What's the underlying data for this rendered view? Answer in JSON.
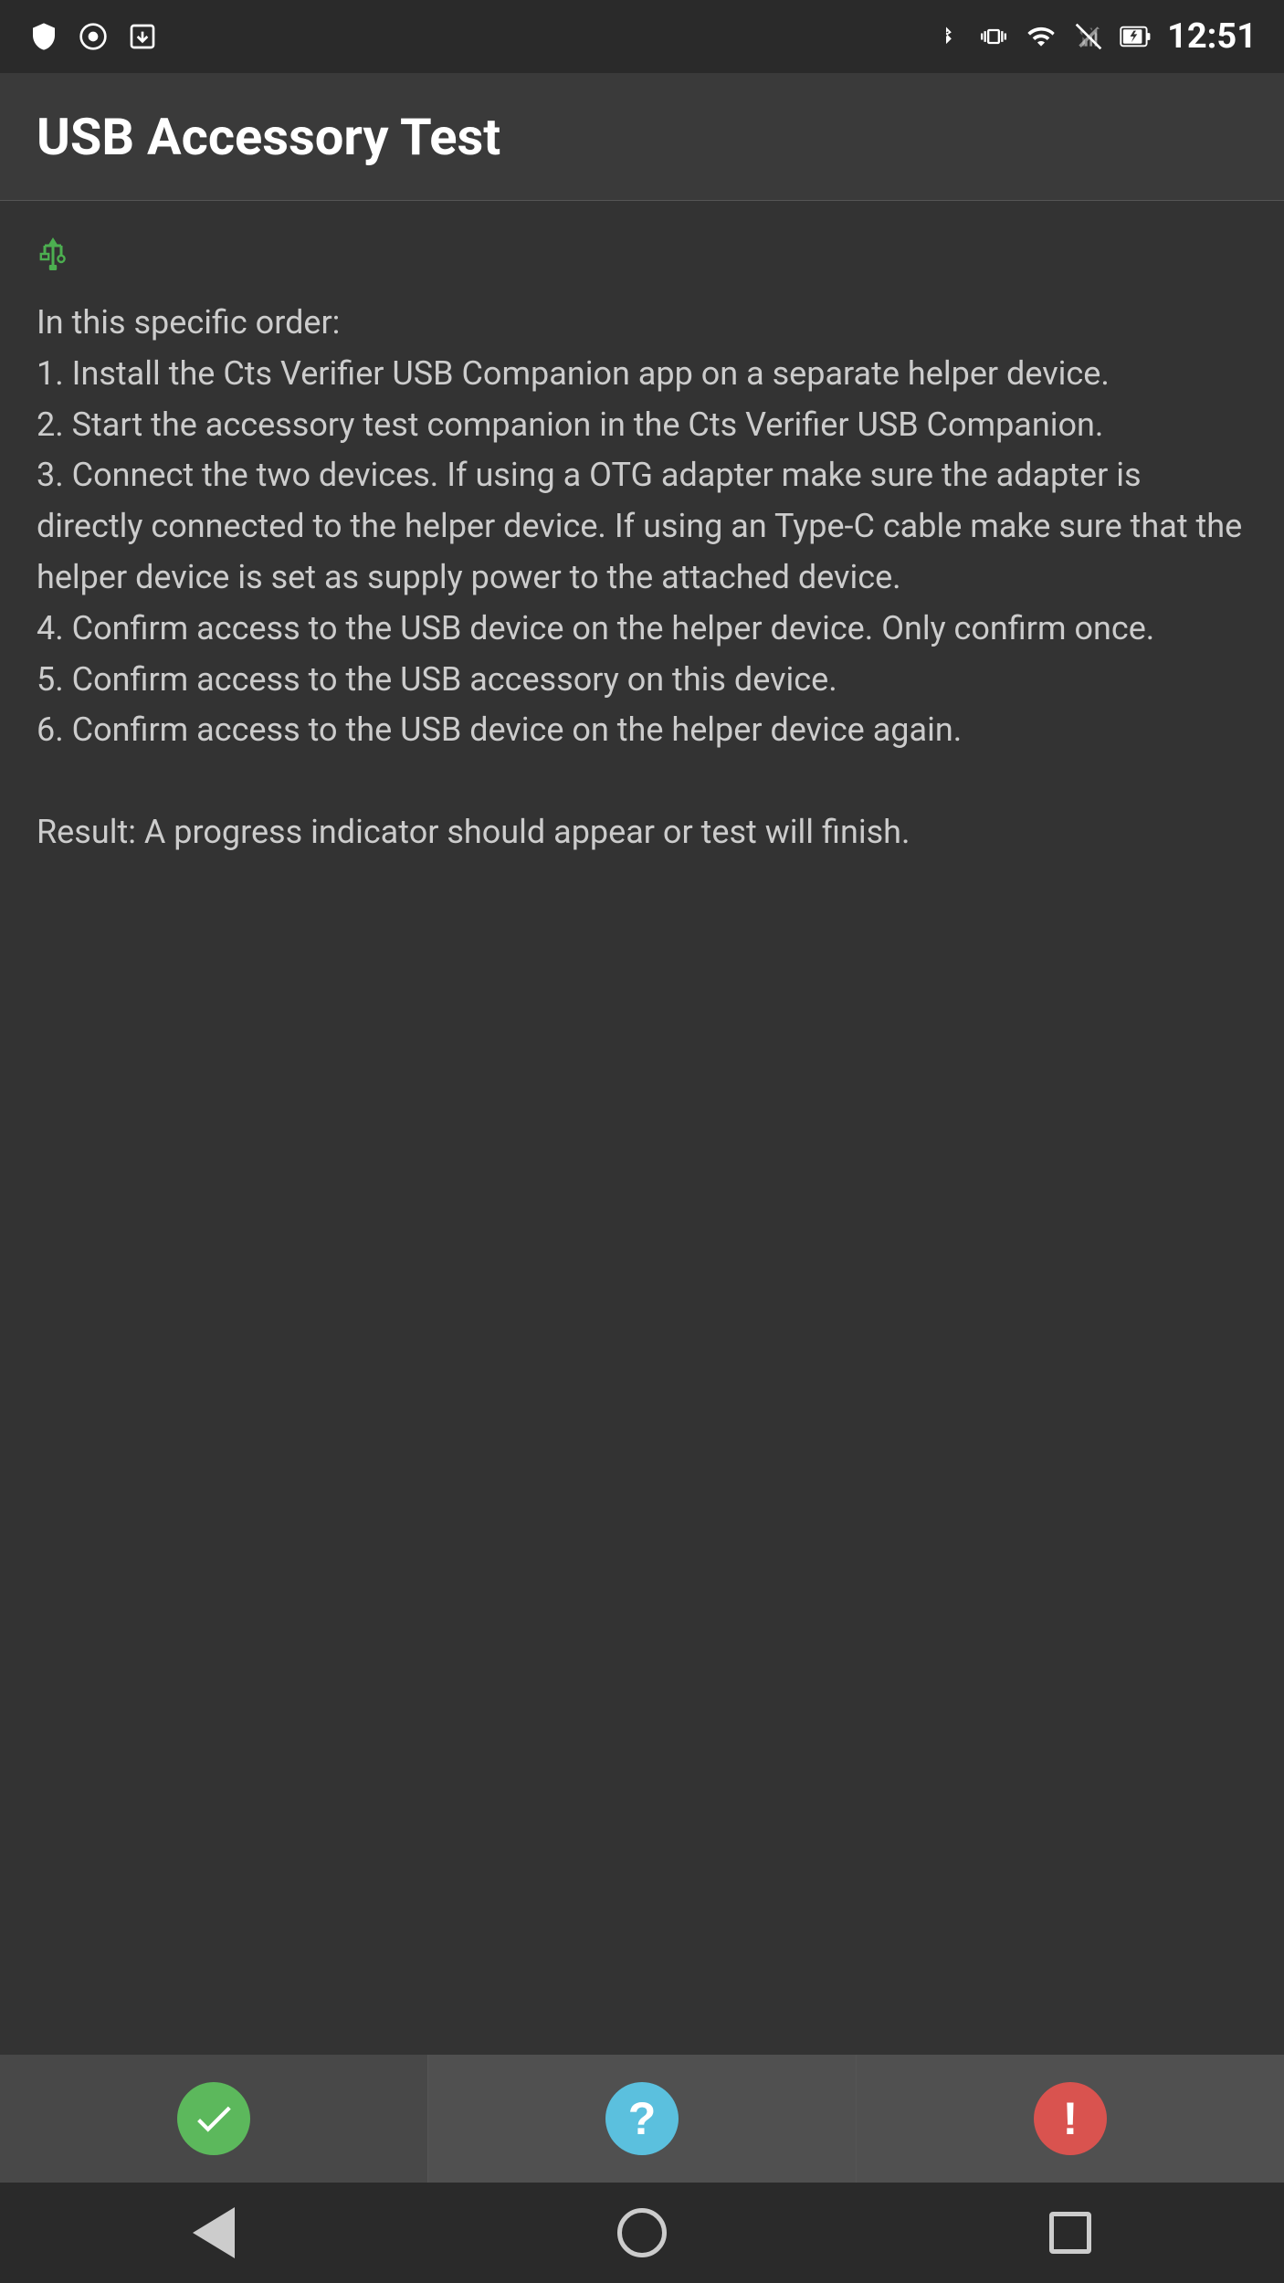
{
  "statusBar": {
    "time": "12:51",
    "leftIcons": [
      "shield",
      "circle-dot",
      "download"
    ],
    "rightIcons": [
      "bluetooth",
      "vibrate",
      "wifi",
      "signal-off",
      "battery"
    ]
  },
  "appBar": {
    "title": "USB Accessory Test"
  },
  "content": {
    "usbIconLabel": "USB symbol",
    "instructions": "In this specific order:\n1. Install the Cts Verifier USB Companion app on a separate helper device.\n2. Start the accessory test companion in the Cts Verifier USB Companion.\n3. Connect the two devices. If using a OTG adapter make sure the adapter is directly connected to the helper device. If using an Type-C cable make sure that the helper device is set as supply power to the attached device.\n4. Confirm access to the USB device on the helper device. Only confirm once.\n5. Confirm access to the USB accessory on this device.\n6. Confirm access to the USB device on the helper device again.\n\nResult: A progress indicator should appear or test will finish."
  },
  "bottomButtons": [
    {
      "id": "pass-button",
      "icon": "checkmark",
      "color": "#5cb85c",
      "label": "Pass"
    },
    {
      "id": "info-button",
      "icon": "question",
      "color": "#5bc0de",
      "label": "Info"
    },
    {
      "id": "fail-button",
      "icon": "exclamation",
      "color": "#d9534f",
      "label": "Fail"
    }
  ],
  "navBar": {
    "backLabel": "Back",
    "homeLabel": "Home",
    "recentsLabel": "Recents"
  }
}
